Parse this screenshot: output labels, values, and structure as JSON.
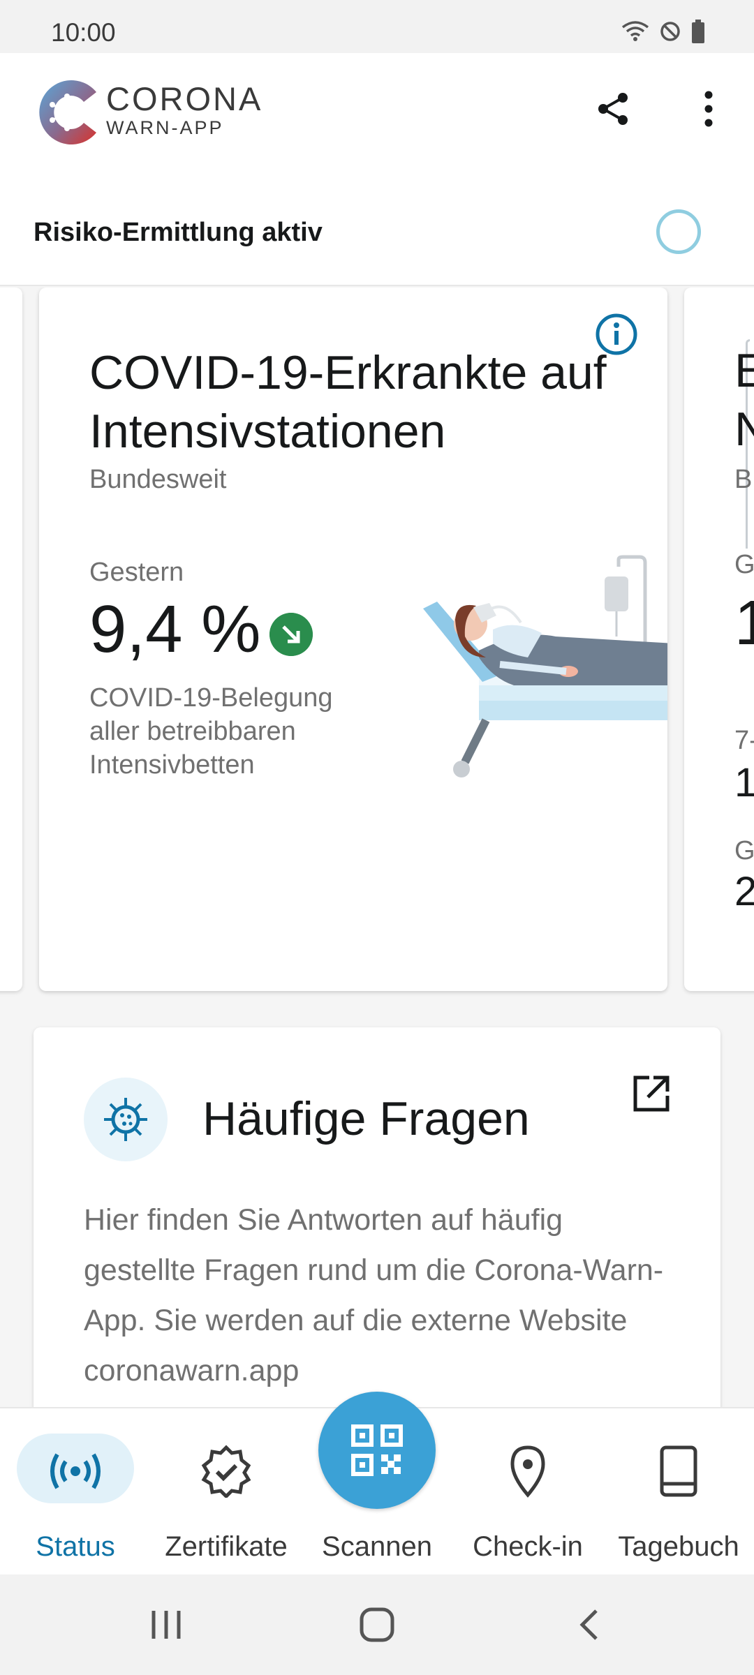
{
  "status_bar": {
    "time": "10:00"
  },
  "app": {
    "logo_line1": "CORONA",
    "logo_line2": "WARN-APP"
  },
  "risk": {
    "label": "Risiko-Ermittlung aktiv"
  },
  "stat_card": {
    "title": "COVID-19-Erkrankte auf Intensivstationen",
    "scope": "Bundesweit",
    "period": "Gestern",
    "value": "9,4 %",
    "trend": "decreasing",
    "description": "COVID-19-Belegung aller betreibbaren Intensivbetten"
  },
  "next_card_partial": {
    "title_l1": "E",
    "title_l2": "N",
    "scope": "B",
    "period": "G",
    "value": "1",
    "row1_label": "7-",
    "row1_value": "1",
    "row2_label": "G",
    "row2_value": "2"
  },
  "faq": {
    "title": "Häufige Fragen",
    "text": "Hier finden Sie Antworten auf häufig gestellte Fragen rund um die Corona-Warn-App. Sie werden auf die externe Website coronawarn.app"
  },
  "nav": {
    "status": "Status",
    "certificates": "Zertifikate",
    "scan": "Scannen",
    "checkin": "Check-in",
    "diary": "Tagebuch"
  },
  "colors": {
    "accent": "#0f73a6",
    "fab": "#3ba1d6",
    "trend_down": "#2a8d4d",
    "ring": "#8fcde0"
  }
}
